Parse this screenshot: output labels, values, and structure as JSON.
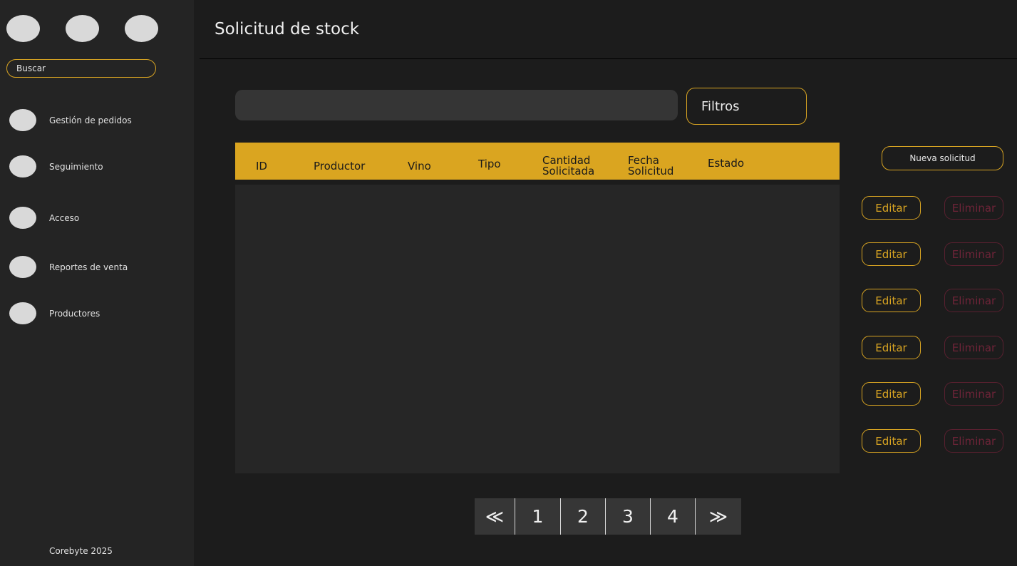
{
  "sidebar": {
    "search_placeholder": "Buscar",
    "items": [
      {
        "label": "Gestión de pedidos"
      },
      {
        "label": "Seguimiento"
      },
      {
        "label": "Acceso"
      },
      {
        "label": "Reportes de venta"
      },
      {
        "label": "Productores"
      }
    ],
    "footer": "Corebyte 2025"
  },
  "header": {
    "title": "Solicitud de stock"
  },
  "filters": {
    "input_value": "",
    "button_label": "Filtros"
  },
  "table": {
    "columns": [
      "ID",
      "Productor",
      "Vino",
      "Tipo",
      "Cantidad Solicitada",
      "Fecha Solicitud",
      "Estado"
    ],
    "rows": []
  },
  "actions": {
    "new_label": "Nueva solicitud",
    "edit_label": "Editar",
    "delete_label": "Eliminar"
  },
  "pagination": {
    "first": "≪",
    "pages": [
      "1",
      "2",
      "3",
      "4"
    ],
    "last": "≫"
  },
  "colors": {
    "accent": "#daa520",
    "danger": "#6e2438",
    "background": "#1c1c1c",
    "sidebar": "#242424"
  }
}
